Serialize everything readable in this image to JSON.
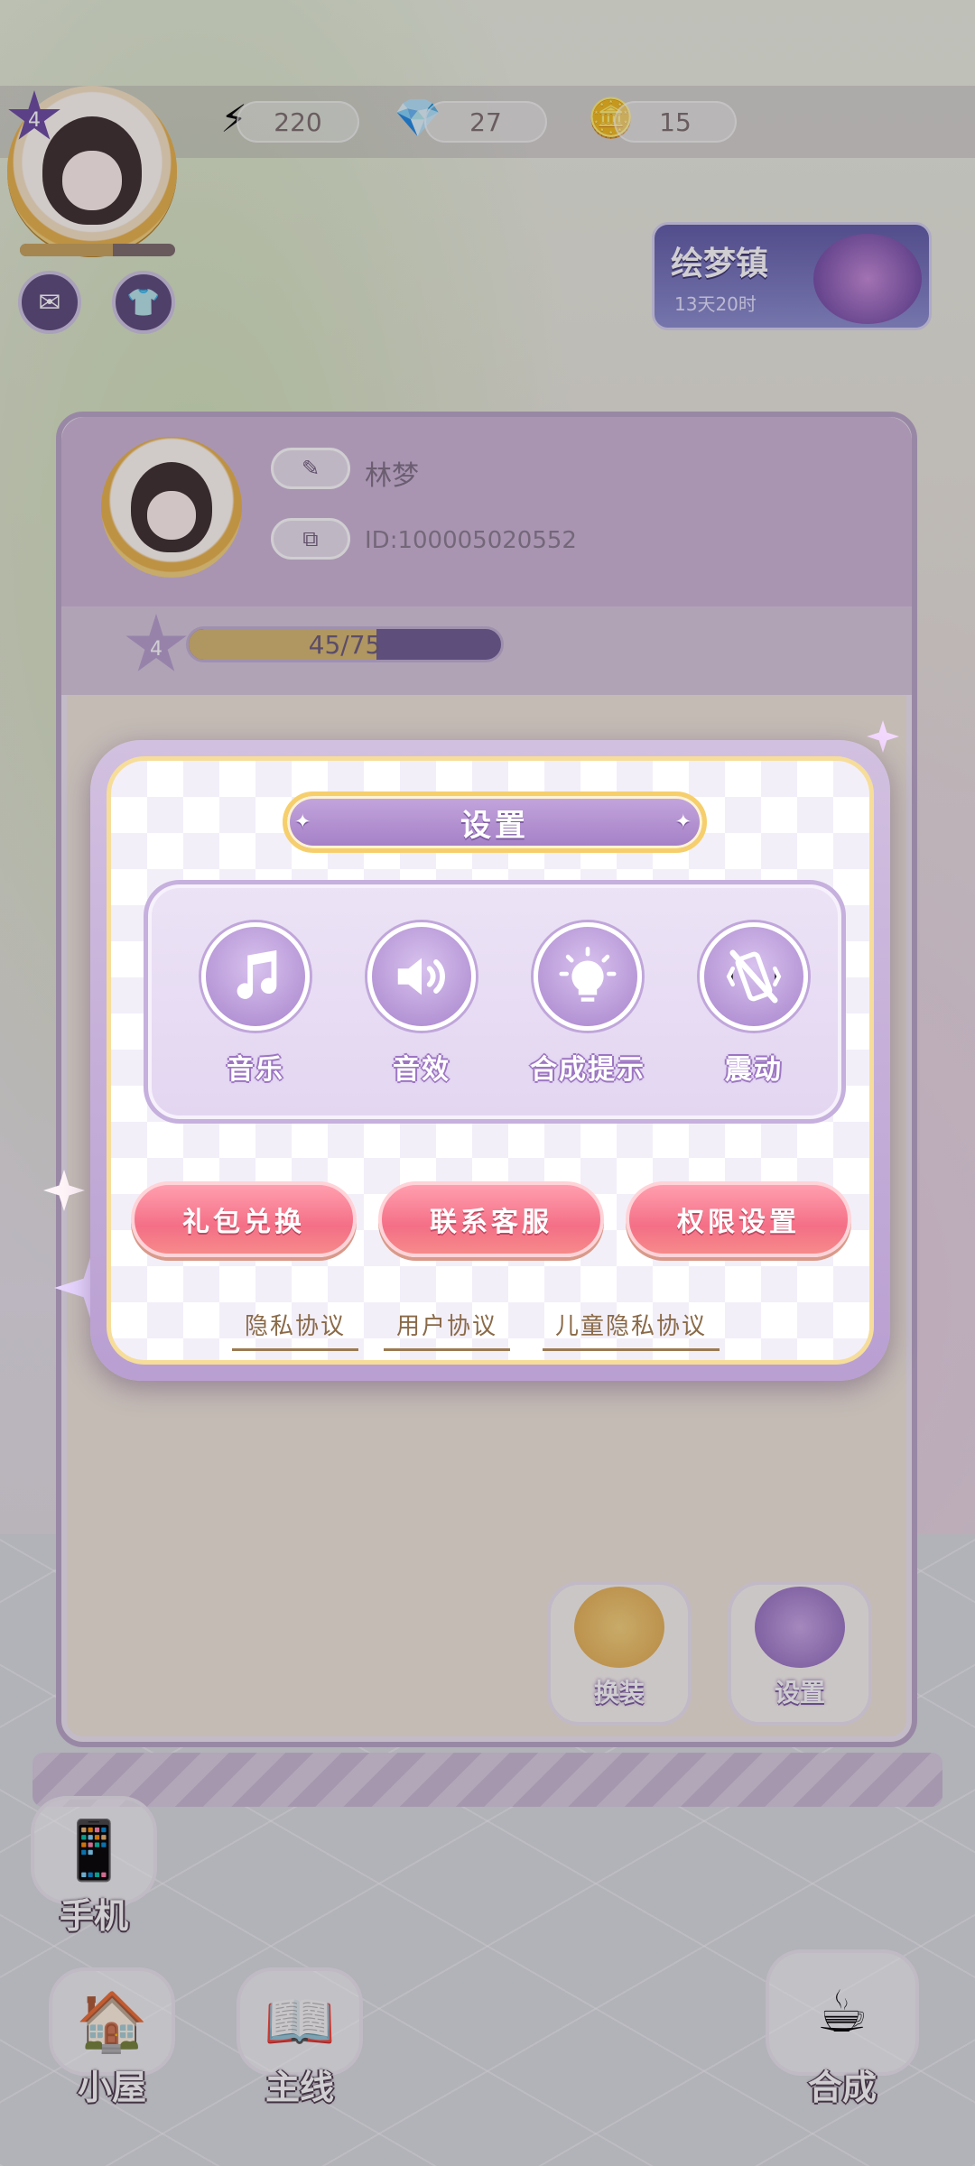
{
  "hud": {
    "player_level": "4",
    "energy": "220",
    "gems": "27",
    "coins": "15",
    "energy_icon": "lightning-icon",
    "gem_icon": "heart-gem-icon",
    "coin_icon": "coin-icon"
  },
  "event": {
    "title": "绘梦镇",
    "countdown": "13天20时"
  },
  "profile": {
    "name": "林梦",
    "id": "ID:100005020552",
    "level": "4",
    "xp_text": "45/75",
    "xp_fraction": 0.6,
    "outfit_label": "换装",
    "settings_label": "设置"
  },
  "settings_modal": {
    "title": "设置",
    "toggles": [
      {
        "label": "音乐",
        "icon": "music-note-icon"
      },
      {
        "label": "音效",
        "icon": "speaker-icon"
      },
      {
        "label": "合成提示",
        "icon": "lightbulb-icon"
      },
      {
        "label": "震动",
        "icon": "vibration-off-icon"
      }
    ],
    "buttons": {
      "gift_redeem": "礼包兑换",
      "contact_support": "联系客服",
      "permission_settings": "权限设置"
    },
    "links": {
      "privacy_policy": "隐私协议",
      "user_agreement": "用户协议",
      "child_privacy": "儿童隐私协议"
    }
  },
  "nav": {
    "phone": "手机",
    "house": "小屋",
    "main_story": "主线",
    "merge": "合成"
  },
  "colors": {
    "modal_purple": "#b99fd2",
    "button_pink": "#f46f86",
    "title_gold": "#f6cf6c"
  }
}
